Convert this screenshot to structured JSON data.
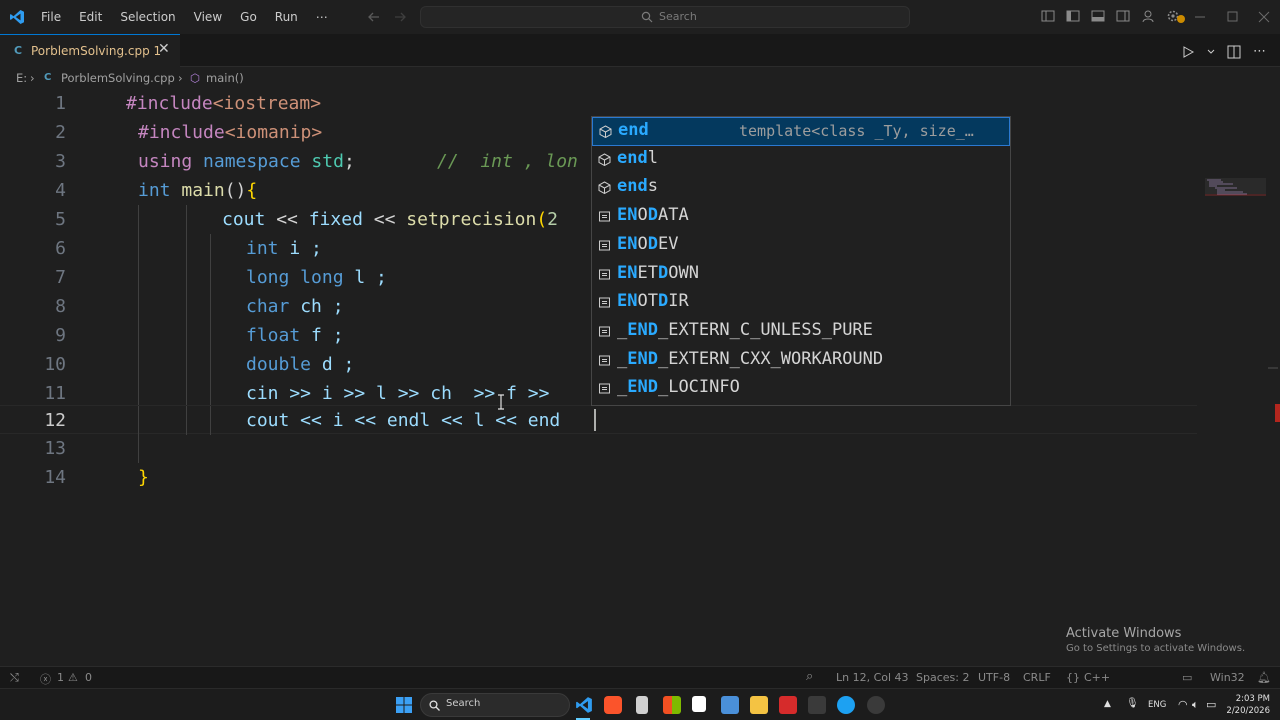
{
  "titlebar": {
    "menu": [
      "File",
      "Edit",
      "Selection",
      "View",
      "Go",
      "Run",
      "⋯"
    ],
    "search_placeholder": "Search"
  },
  "tab": {
    "name": "PorblemSolving.cpp",
    "problems": "1",
    "icon_text": "C"
  },
  "breadcrumb": {
    "root": "E:",
    "file": "PorblemSolving.cpp",
    "symbol": "main()"
  },
  "line_numbers": [
    "1",
    "2",
    "3",
    "4",
    "5",
    "6",
    "7",
    "8",
    "9",
    "10",
    "11",
    "12",
    "13",
    "14"
  ],
  "code": {
    "l1": {
      "inc": "#include",
      "hdr": "<iostream>"
    },
    "l2": {
      "inc": "#include",
      "hdr": "<iomanip>"
    },
    "l3": {
      "using": "using",
      "ns": "namespace",
      "std": "std",
      "semi": ";",
      "comment": "//  int , lon"
    },
    "l4": {
      "int": "int",
      "main": "main",
      "paren": "()",
      "brace": "{"
    },
    "l5": {
      "cout": "cout",
      "op": " << ",
      "fixed": "fixed",
      "op2": " << ",
      "setp": "setprecision",
      "paren": "(",
      "num": "2"
    },
    "l6": {
      "t": "int",
      "rest": " i ;"
    },
    "l7": {
      "t": "long long",
      "rest": " l ;"
    },
    "l8": {
      "t": "char",
      "rest": " ch ;"
    },
    "l9": {
      "t": "float",
      "rest": " f ;"
    },
    "l10": {
      "t": "double",
      "rest": " d ;"
    },
    "l11": {
      "text": "cin >> i >> l >> ch  >> f >>"
    },
    "l12": {
      "text": "cout << i << endl << l << end"
    },
    "l14": {
      "brace": "}"
    }
  },
  "suggestions": [
    {
      "match": "end",
      "rest": "",
      "detail": "template<class _Ty, size_…",
      "kind": "function",
      "selected": true
    },
    {
      "match": "end",
      "rest": "l",
      "detail": "",
      "kind": "function",
      "selected": false
    },
    {
      "match": "end",
      "rest": "s",
      "detail": "",
      "kind": "function",
      "selected": false
    },
    {
      "match": "EN",
      "rest": "O",
      "match2": "D",
      "rest2": "ATA",
      "kind": "constant"
    },
    {
      "match": "EN",
      "rest": "O",
      "match2": "D",
      "rest2": "EV",
      "kind": "constant"
    },
    {
      "match": "EN",
      "rest": "ET",
      "match2": "D",
      "rest2": "OWN",
      "kind": "constant"
    },
    {
      "match": "EN",
      "rest": "OT",
      "match2": "D",
      "rest2": "IR",
      "kind": "constant"
    },
    {
      "pre": "_",
      "match": "END",
      "rest": "_EXTERN_C_UNLESS_PURE",
      "kind": "constant"
    },
    {
      "pre": "_",
      "match": "END",
      "rest": "_EXTERN_CXX_WORKAROUND",
      "kind": "constant"
    },
    {
      "pre": "_",
      "match": "END",
      "rest": "_LOCINFO",
      "kind": "constant"
    }
  ],
  "watermark": {
    "title": "Activate Windows",
    "subtitle": "Go to Settings to activate Windows."
  },
  "statusbar": {
    "errors": "1",
    "warnings": "0",
    "position": "Ln 12, Col 43",
    "spaces": "Spaces: 2",
    "encoding": "UTF-8",
    "eol": "CRLF",
    "language": "C++",
    "platform": "Win32"
  },
  "taskbar": {
    "search": "Search",
    "lang": "ENG",
    "time": "2:03 PM",
    "date": "2/20/2026"
  },
  "colors": {
    "accent": "#0078d4",
    "suggest_match": "#2aaaff",
    "tab_modified": "#e2c08d"
  }
}
